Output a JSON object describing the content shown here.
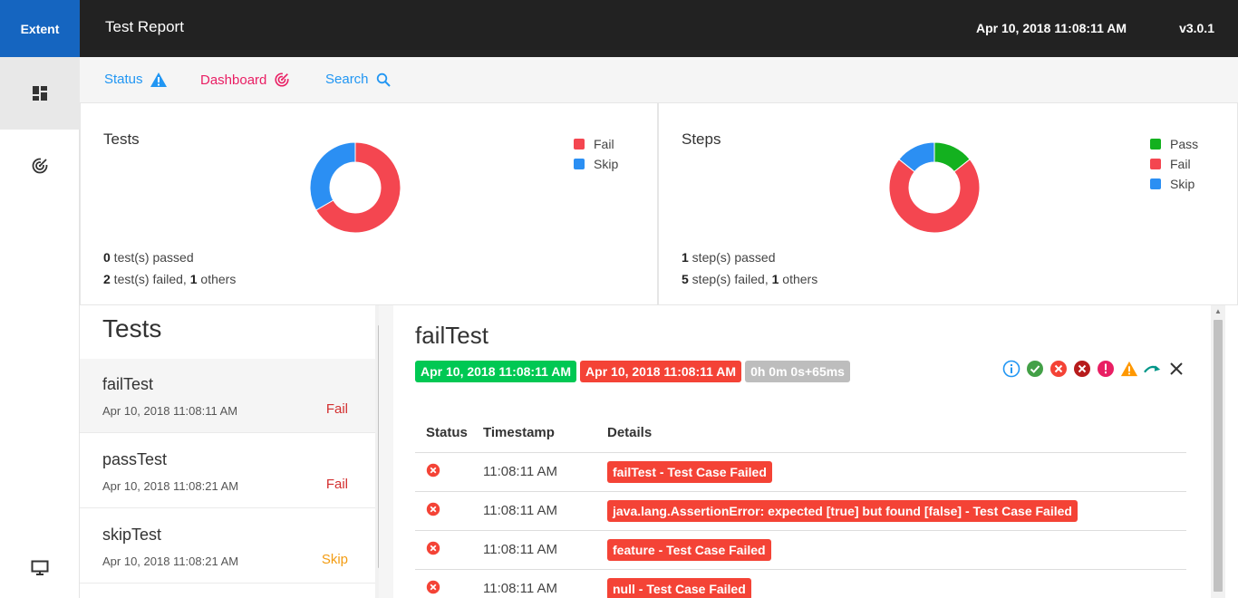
{
  "topbar": {
    "brand": "Extent",
    "report_name": "Test Report",
    "date": "Apr 10, 2018 11:08:11 AM",
    "version": "v3.0.1"
  },
  "sidenav": {
    "items": [
      {
        "icon": "dashboard-grid-icon"
      },
      {
        "icon": "target-icon"
      },
      {
        "icon": "monitor-icon"
      }
    ]
  },
  "subnav": {
    "status_label": "Status",
    "dashboard_label": "Dashboard",
    "search_label": "Search",
    "colors": {
      "status": "#2196f3",
      "dashboard": "#e91e63",
      "search": "#2196f3"
    }
  },
  "summary": {
    "tests": {
      "title": "Tests",
      "legend": [
        {
          "label": "Fail",
          "color": "#f44650"
        },
        {
          "label": "Skip",
          "color": "#2b8ff3"
        }
      ],
      "passed_count": "0",
      "passed_text": " test(s) passed",
      "failed_count": "2",
      "failed_text": " test(s) failed, ",
      "others_count": "1",
      "others_text": " others"
    },
    "steps": {
      "title": "Steps",
      "legend": [
        {
          "label": "Pass",
          "color": "#13b11f"
        },
        {
          "label": "Fail",
          "color": "#f44650"
        },
        {
          "label": "Skip",
          "color": "#2b8ff3"
        }
      ],
      "passed_count": "1",
      "passed_text": " step(s) passed",
      "failed_count": "5",
      "failed_text": " step(s) failed, ",
      "others_count": "1",
      "others_text": " others"
    }
  },
  "chart_data": [
    {
      "type": "pie",
      "title": "Tests",
      "categories": [
        "Fail",
        "Skip"
      ],
      "values": [
        2,
        1
      ],
      "colors": [
        "#f44650",
        "#2b8ff3"
      ]
    },
    {
      "type": "pie",
      "title": "Steps",
      "categories": [
        "Pass",
        "Fail",
        "Skip"
      ],
      "values": [
        1,
        5,
        1
      ],
      "colors": [
        "#13b11f",
        "#f44650",
        "#2b8ff3"
      ]
    }
  ],
  "test_list": {
    "heading": "Tests",
    "items": [
      {
        "name": "failTest",
        "date": "Apr 10, 2018 11:08:11 AM",
        "status": "Fail"
      },
      {
        "name": "passTest",
        "date": "Apr 10, 2018 11:08:21 AM",
        "status": "Fail"
      },
      {
        "name": "skipTest",
        "date": "Apr 10, 2018 11:08:21 AM",
        "status": "Skip"
      }
    ]
  },
  "detail": {
    "title": "failTest",
    "start_time": "Apr 10, 2018 11:08:11 AM",
    "end_time": "Apr 10, 2018 11:08:11 AM",
    "duration": "0h 0m 0s+65ms",
    "filters": [
      "info-icon",
      "pass-icon",
      "fail-icon",
      "fatal-icon",
      "error-icon",
      "warning-icon",
      "skip-icon",
      "clear-filter-icon"
    ],
    "table": {
      "headers": [
        "Status",
        "Timestamp",
        "Details"
      ],
      "rows": [
        {
          "status_icon": "fail-icon",
          "timestamp": "11:08:11 AM",
          "details": "failTest - Test Case Failed"
        },
        {
          "status_icon": "fail-icon",
          "timestamp": "11:08:11 AM",
          "details": "java.lang.AssertionError: expected [true] but found [false] - Test Case Failed"
        },
        {
          "status_icon": "fail-icon",
          "timestamp": "11:08:11 AM",
          "details": "feature - Test Case Failed"
        },
        {
          "status_icon": "fail-icon",
          "timestamp": "11:08:11 AM",
          "details": "null - Test Case Failed"
        }
      ]
    }
  }
}
